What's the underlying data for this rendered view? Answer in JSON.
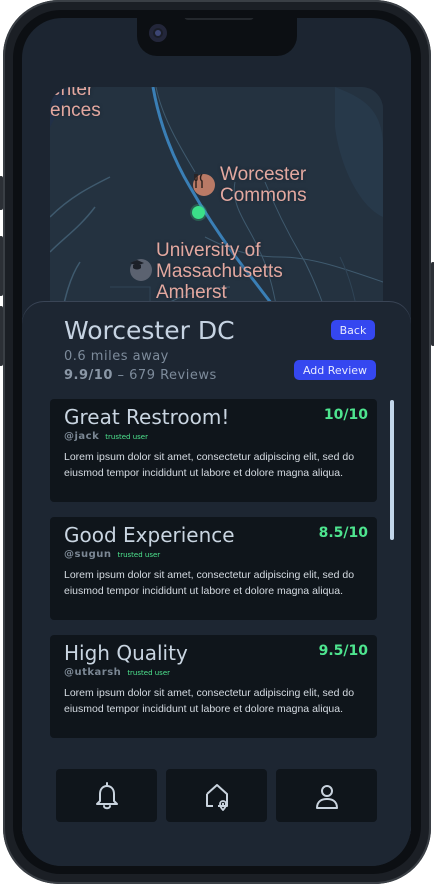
{
  "map": {
    "labels": {
      "top_left": "enter\nences",
      "commons": "Worcester\nCommons",
      "university": "University of\nMassachusetts\nAmherst"
    },
    "icons": [
      "restaurant-icon",
      "school-icon",
      "current-location-dot"
    ]
  },
  "location": {
    "title": "Worcester DC",
    "distance": "0.6 miles away",
    "score": "9.9/10",
    "review_count": "– 679 Reviews"
  },
  "actions": {
    "back_label": "Back",
    "add_review_label": "Add Review"
  },
  "reviews": [
    {
      "title": "Great Restroom!",
      "score": "10/10",
      "user": "@jack",
      "badge": "trusted user",
      "body": "Lorem ipsum dolor sit amet, consectetur adipiscing elit, sed do eiusmod tempor incididunt ut labore et dolore magna aliqua."
    },
    {
      "title": "Good Experience",
      "score": "8.5/10",
      "user": "@sugun",
      "badge": "trusted user",
      "body": "Lorem ipsum dolor sit amet, consectetur adipiscing elit, sed do eiusmod tempor incididunt ut labore et dolore magna aliqua."
    },
    {
      "title": "High Quality",
      "score": "9.5/10",
      "user": "@utkarsh",
      "badge": "trusted user",
      "body": "Lorem ipsum dolor sit amet, consectetur adipiscing elit, sed do eiusmod tempor incididunt ut labore et dolore magna aliqua."
    }
  ],
  "bottom_nav": [
    "bell-icon",
    "home-pin-icon",
    "user-icon"
  ],
  "colors": {
    "accent": "#3547f0",
    "score": "#4ee58f",
    "background": "#1c2531",
    "card": "#0f151b",
    "location_dot": "#3be089"
  }
}
